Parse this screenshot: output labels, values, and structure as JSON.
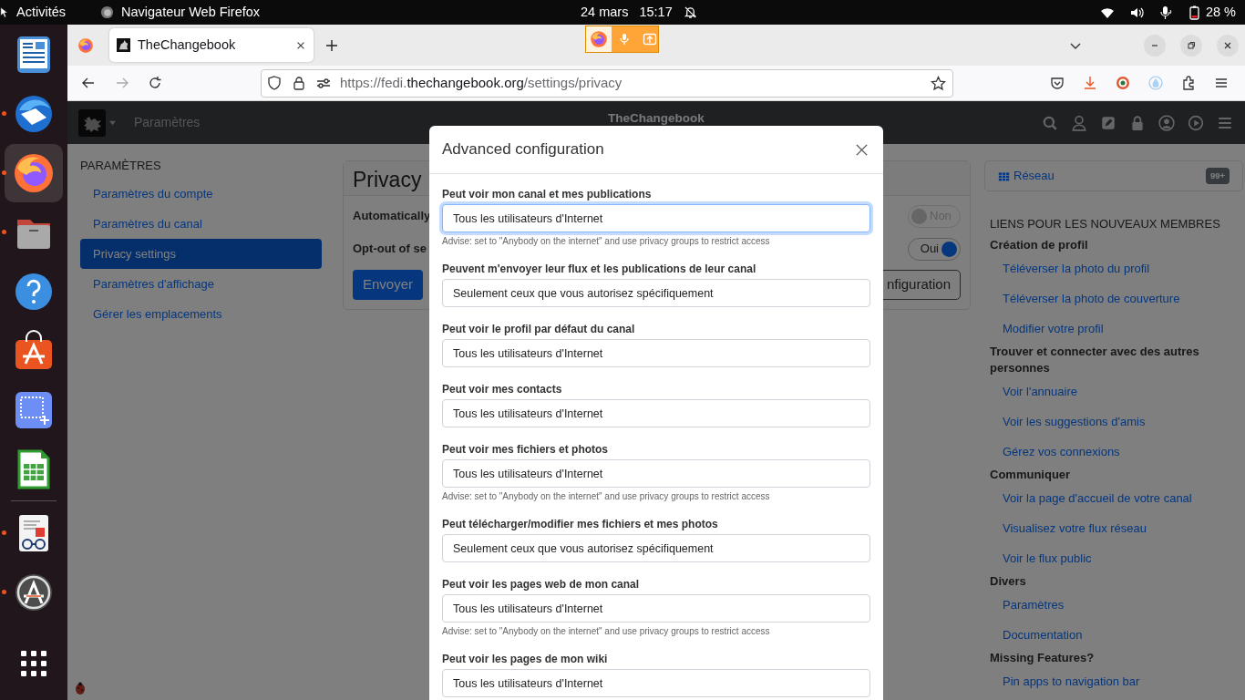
{
  "top_bar": {
    "activities": "Activités",
    "app_name": "Navigateur Web Firefox",
    "date": "24 mars",
    "time": "15:17",
    "battery": "28 %"
  },
  "dock": [
    {
      "kind": "news",
      "running": false,
      "selected": false
    },
    {
      "kind": "mail",
      "running": true,
      "selected": false
    },
    {
      "kind": "firefox",
      "running": true,
      "selected": true
    },
    {
      "kind": "files",
      "running": true,
      "selected": false
    },
    {
      "kind": "help",
      "running": false,
      "selected": false
    },
    {
      "kind": "store",
      "running": false,
      "selected": false
    },
    {
      "kind": "screenshot",
      "running": false,
      "selected": false
    },
    {
      "kind": "spreadsheet",
      "running": false,
      "selected": false
    },
    {
      "kind": "separator"
    },
    {
      "kind": "reader",
      "running": true,
      "selected": false
    },
    {
      "kind": "updater",
      "running": true,
      "selected": false
    },
    {
      "kind": "apps",
      "running": false,
      "selected": false
    }
  ],
  "browser": {
    "tabs": [
      {
        "title": "TheChangebook",
        "selected": true
      }
    ],
    "url_parts": [
      {
        "text": "https://fedi.",
        "emphasis": false
      },
      {
        "text": "thechangebook.org",
        "emphasis": true
      },
      {
        "text": "/settings/privacy",
        "emphasis": false
      }
    ]
  },
  "navbar": {
    "section": "Paramètres",
    "site_name": "TheChangebook"
  },
  "sidebar": {
    "heading": "PARAMÈTRES",
    "items": [
      {
        "label": "Paramètres du compte",
        "selected": false
      },
      {
        "label": "Paramètres du canal",
        "selected": false
      },
      {
        "label": "Privacy settings",
        "selected": true
      },
      {
        "label": "Paramètres d'affichage",
        "selected": false
      },
      {
        "label": "Gérer les emplacements",
        "selected": false
      }
    ]
  },
  "privacy_card": {
    "title": "Privacy",
    "rows": [
      {
        "label": "Automatically",
        "toggle": "Non",
        "on": false
      },
      {
        "label": "Opt-out of se",
        "toggle": "Oui",
        "on": true
      }
    ],
    "submit": "Envoyer",
    "config_button": "nfiguration"
  },
  "right_panel": {
    "network": {
      "label": "Réseau",
      "badge": "99+"
    },
    "heading": "LIENS POUR LES NOUVEAUX MEMBRES",
    "sections": [
      {
        "title": "Création de profil",
        "links": [
          "Téléverser la photo du profil",
          "Téléverser la photo de couverture",
          "Modifier votre profil"
        ]
      },
      {
        "title": "Trouver et connecter avec des autres personnes",
        "links": [
          "Voir l'annuaire",
          "Voir les suggestions d'amis",
          "Gérez vos connexions"
        ]
      },
      {
        "title": "Communiquer",
        "links": [
          "Voir la page d'accueil de votre canal",
          "Visualisez votre flux réseau",
          "Voir le flux public"
        ]
      },
      {
        "title": "Divers",
        "links": [
          "Paramètres",
          "Documentation"
        ]
      },
      {
        "title": "Missing Features?",
        "links": [
          "Pin apps to navigation bar"
        ]
      }
    ]
  },
  "modal": {
    "title": "Advanced configuration",
    "fields": [
      {
        "label": "Peut voir mon canal et mes publications",
        "value": "Tous les utilisateurs d'Internet",
        "focused": true,
        "hint": "Advise: set to \"Anybody on the internet\" and use privacy groups to restrict access"
      },
      {
        "label": "Peuvent m'envoyer leur flux et les publications de leur canal",
        "value": "Seulement ceux que vous autorisez spécifiquement",
        "focused": false
      },
      {
        "label": "Peut voir le profil par défaut du canal",
        "value": "Tous les utilisateurs d'Internet",
        "focused": false
      },
      {
        "label": "Peut voir mes contacts",
        "value": "Tous les utilisateurs d'Internet",
        "focused": false
      },
      {
        "label": "Peut voir mes fichiers et photos",
        "value": "Tous les utilisateurs d'Internet",
        "focused": false,
        "hint": "Advise: set to \"Anybody on the internet\" and use privacy groups to restrict access"
      },
      {
        "label": "Peut télécharger/modifier mes fichiers et mes photos",
        "value": "Seulement ceux que vous autorisez spécifiquement",
        "focused": false
      },
      {
        "label": "Peut voir les pages web de mon canal",
        "value": "Tous les utilisateurs d'Internet",
        "focused": false,
        "hint": "Advise: set to \"Anybody on the internet\" and use privacy groups to restrict access"
      },
      {
        "label": "Peut voir les pages de mon wiki",
        "value": "Tous les utilisateurs d'Internet",
        "focused": false
      }
    ]
  }
}
